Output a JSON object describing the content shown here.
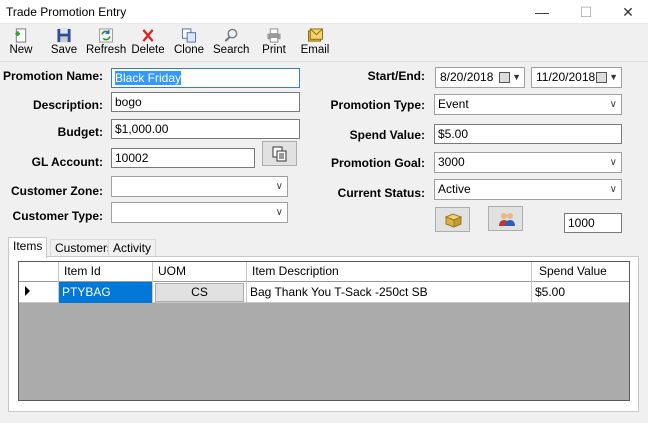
{
  "window": {
    "title": "Trade Promotion Entry",
    "minimize": "—",
    "maximize": "☐",
    "close": "✕"
  },
  "toolbar": {
    "new": "New",
    "save": "Save",
    "refresh": "Refresh",
    "delete": "Delete",
    "clone": "Clone",
    "search": "Search",
    "print": "Print",
    "email": "Email"
  },
  "form": {
    "promotion_name_label": "Promotion Name:",
    "promotion_name": "Black Friday",
    "description_label": "Description:",
    "description": "bogo",
    "budget_label": "Budget:",
    "budget": "$1,000.00",
    "gl_account_label": "GL Account:",
    "gl_account": "10002",
    "customer_zone_label": "Customer Zone:",
    "customer_zone": "",
    "customer_type_label": "Customer Type:",
    "customer_type": "",
    "start_end_label": "Start/End:",
    "start_date": "8/20/2018",
    "end_date": "11/20/2018",
    "promotion_type_label": "Promotion Type:",
    "promotion_type": "Event",
    "spend_value_label": "Spend Value:",
    "spend_value": "$5.00",
    "promotion_goal_label": "Promotion Goal:",
    "promotion_goal": "3000",
    "current_status_label": "Current Status:",
    "current_status": "Active",
    "quantity": "1000"
  },
  "tabs": [
    {
      "label": "Items"
    },
    {
      "label": "Customers"
    },
    {
      "label": "Activity"
    }
  ],
  "grid": {
    "columns": [
      "Item Id",
      "UOM",
      "Item Description",
      "Spend Value"
    ],
    "rows": [
      {
        "item_id": "PTYBAG",
        "uom": "CS",
        "description": "Bag Thank You T-Sack -250ct SB",
        "spend_value": "$5.00"
      }
    ]
  }
}
